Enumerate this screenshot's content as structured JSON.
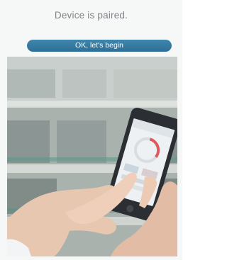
{
  "pairing": {
    "status_text": "Device is paired.",
    "begin_button_label": "OK, let's begin"
  },
  "colors": {
    "button": "#3579a2",
    "title_text": "#7d8487",
    "background": "#f6f7f7"
  },
  "icons": {
    "photo": "hands-holding-smartphone-illustration"
  }
}
